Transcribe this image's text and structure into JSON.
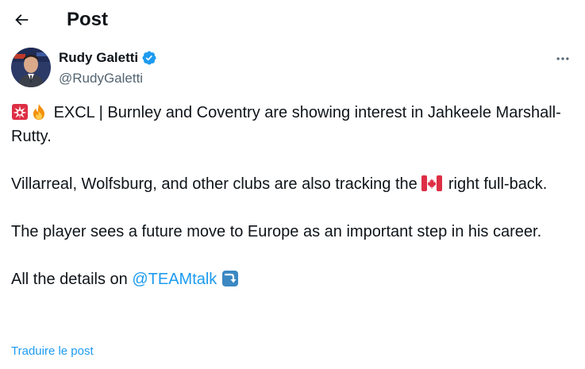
{
  "header": {
    "title": "Post",
    "back_icon": "arrow-left-icon"
  },
  "author": {
    "name": "Rudy Galetti",
    "handle": "@RudyGaletti",
    "verified": true,
    "verified_color": "#1d9bf0"
  },
  "tweet": {
    "line1_emojis": [
      "siren-emoji",
      "fire-emoji"
    ],
    "paragraph1": "EXCL | Burnley and Coventry are showing interest in Jahkeele Marshall-Rutty.",
    "paragraph2_before_flag": "Villarreal, Wolfsburg, and other clubs are also tracking the",
    "paragraph2_flag": "canada-flag-emoji",
    "paragraph2_after_flag": "right full-back.",
    "paragraph3": "The player sees a future move to Europe as an important step in his career.",
    "paragraph4_prefix": "All the details on",
    "paragraph4_mention": "@TEAMtalk",
    "paragraph4_emoji": "right-arrow-curving-down-emoji"
  },
  "translate_label": "Traduire le post",
  "colors": {
    "text": "#0f1419",
    "secondary": "#536471",
    "link": "#1d9bf0"
  }
}
